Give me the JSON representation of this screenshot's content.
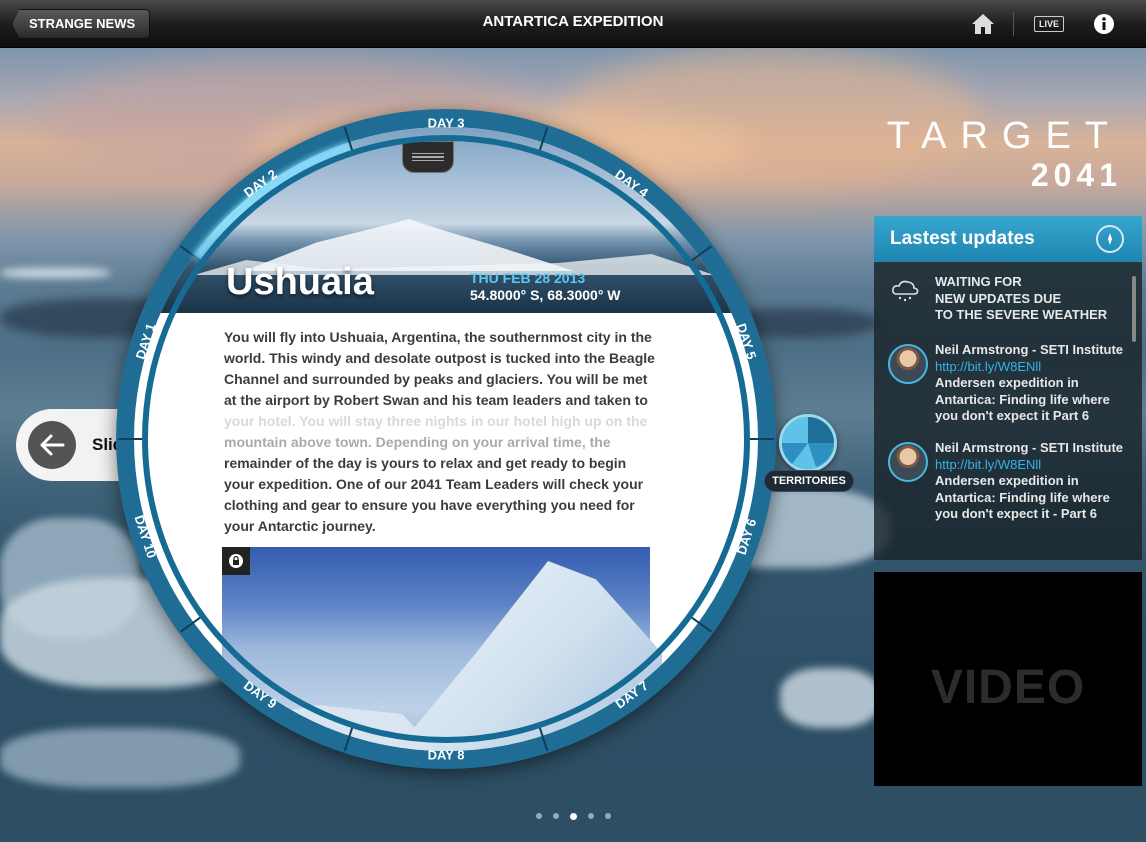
{
  "header": {
    "back_label": "STRANGE NEWS",
    "title": "ANTARTICA EXPEDITION",
    "live_label": "LIVE",
    "icons": [
      "home-icon",
      "live-icon",
      "info-icon"
    ]
  },
  "brand": {
    "line1": "TARGET",
    "line2": "2041"
  },
  "dial": {
    "days": [
      "DAY 1",
      "DAY 2",
      "DAY 3",
      "DAY 4",
      "DAY 5",
      "DAY 6",
      "DAY 7",
      "DAY 8",
      "DAY 9",
      "DAY 10"
    ],
    "active_day": "DAY 2"
  },
  "card": {
    "city": "Ushuaia",
    "date": "THU FEB 28 2013",
    "coords": "54.8000° S, 68.3000° W",
    "body": "You will fly into Ushuaia, Argentina, the southernmost city in the world. This windy and desolate outpost is tucked into the Beagle Channel and surrounded by peaks and glaciers. You will be met at the airport by Robert Swan and his team leaders and taken to your hotel. You will stay three nights in our hotel high up on the mountain above town. Depending on your arrival time, the remainder of the day is yours to relax and get ready to begin your expedition. One of our 2041 Team Leaders will check your clothing and gear to ensure you have everything you need for your Antarctic journey."
  },
  "flip": {
    "label": "Slide to flip"
  },
  "territories": {
    "label": "TERRITORIES"
  },
  "updates": {
    "title": "Lastest updates",
    "weather": "WAITING FOR\nNEW UPDATES DUE\nTO THE SEVERE WEATHER",
    "items": [
      {
        "author": "Neil Armstrong - SETI Institute",
        "link": "http://bit.ly/W8ENll",
        "text": "Andersen expedition in Antartica: Finding life where you don't expect it  Part 6"
      },
      {
        "author": "Neil Armstrong - SETI Institute",
        "link": "http://bit.ly/W8ENll",
        "text": "Andersen expedition in Antartica: Finding life where you don't expect it - Part 6"
      }
    ]
  },
  "video": {
    "label": "VIDEO"
  },
  "pager": {
    "count": 5,
    "active": 2
  },
  "colors": {
    "accent": "#1d8fc5",
    "highlight": "#5cc7f0",
    "link": "#35b2e6"
  }
}
